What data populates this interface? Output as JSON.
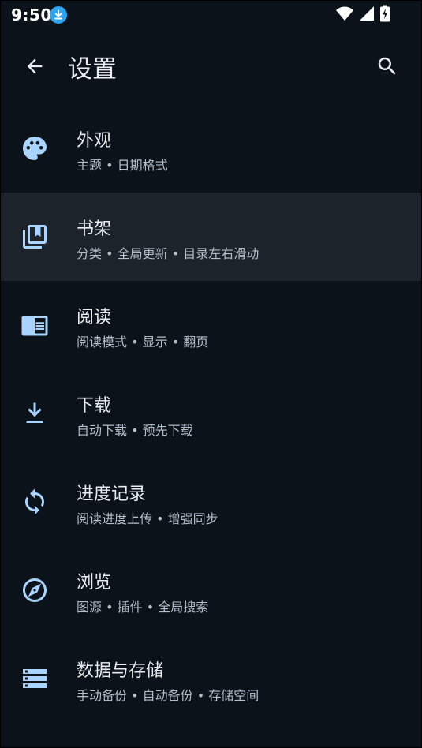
{
  "status_bar": {
    "time": "9:50",
    "icons": [
      "download-icon",
      "wifi-icon",
      "signal-icon",
      "battery-charging-icon"
    ]
  },
  "app_bar": {
    "title": "设置",
    "back_icon": "arrow-back-icon",
    "search_icon": "search-icon"
  },
  "colors": {
    "background": "#0b121a",
    "selected_row": "#1c232b",
    "accent_icon": "#a8d4ff",
    "download_badge": "#2aa3f0"
  },
  "settings": {
    "items": [
      {
        "title": "外观",
        "subtitle": "主题 • 日期格式",
        "icon": "palette-icon",
        "selected": false
      },
      {
        "title": "书架",
        "subtitle": "分类 • 全局更新 • 目录左右滑动",
        "icon": "library-icon",
        "selected": true
      },
      {
        "title": "阅读",
        "subtitle": "阅读模式 • 显示 • 翻页",
        "icon": "chrome-reader-icon",
        "selected": false
      },
      {
        "title": "下载",
        "subtitle": "自动下载 • 预先下载",
        "icon": "download-icon",
        "selected": false
      },
      {
        "title": "进度记录",
        "subtitle": "阅读进度上传 • 增强同步",
        "icon": "sync-icon",
        "selected": false
      },
      {
        "title": "浏览",
        "subtitle": "图源 • 插件 • 全局搜索",
        "icon": "explore-icon",
        "selected": false
      },
      {
        "title": "数据与存储",
        "subtitle": "手动备份 • 自动备份 • 存储空间",
        "icon": "storage-icon",
        "selected": false
      }
    ]
  }
}
